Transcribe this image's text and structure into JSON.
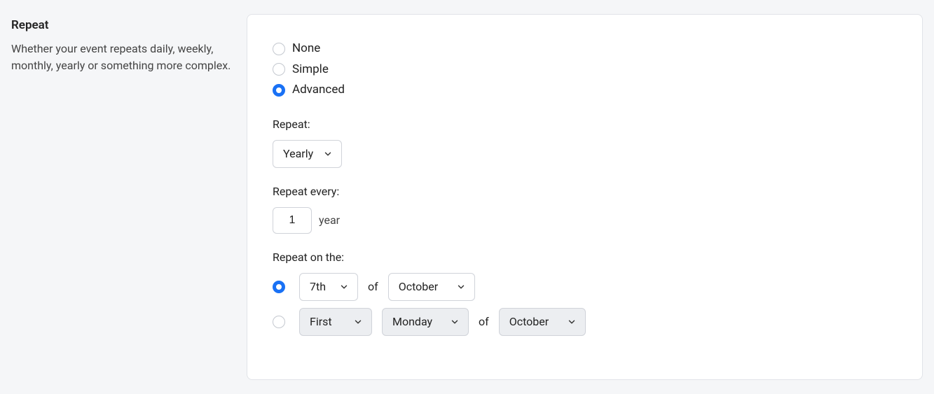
{
  "sidebar": {
    "title": "Repeat",
    "description": "Whether your event repeats daily, weekly, monthly, yearly or something more complex."
  },
  "mode": {
    "options": [
      {
        "label": "None",
        "selected": false
      },
      {
        "label": "Simple",
        "selected": false
      },
      {
        "label": "Advanced",
        "selected": true
      }
    ]
  },
  "repeat": {
    "label": "Repeat:",
    "value": "Yearly"
  },
  "repeat_every": {
    "label": "Repeat every:",
    "value": "1",
    "unit": "year"
  },
  "repeat_on": {
    "label": "Repeat on the:",
    "of_text": "of",
    "option1": {
      "selected": true,
      "day": "7th",
      "month": "October"
    },
    "option2": {
      "selected": false,
      "ordinal": "First",
      "weekday": "Monday",
      "month": "October"
    }
  }
}
